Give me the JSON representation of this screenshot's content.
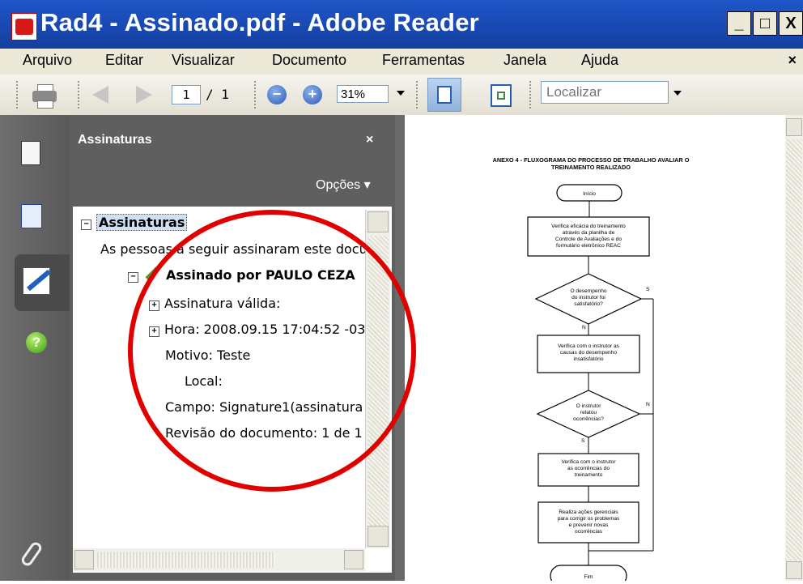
{
  "window": {
    "title": "Rad4 - Assinado.pdf - Adobe Reader",
    "buttons": [
      "_",
      "□",
      "X"
    ]
  },
  "menu": {
    "items": [
      "Arquivo",
      "Editar",
      "Visualizar",
      "Documento",
      "Ferramentas",
      "Janela",
      "Ajuda"
    ],
    "close": "×"
  },
  "toolbar": {
    "page_current": "1",
    "page_total": "/ 1",
    "zoom_out": "−",
    "zoom_in": "+",
    "zoom": "31%",
    "search_placeholder": "Localizar"
  },
  "nav": {
    "icons": [
      "pages-icon",
      "bookmarks-icon",
      "signatures-icon",
      "help-icon",
      "attachment-icon"
    ],
    "help_glyph": "?"
  },
  "panel": {
    "title": "Assinaturas",
    "close": "×",
    "options": "Opções ▾",
    "tree": {
      "root": "Assinaturas",
      "intro": "As pessoas a seguir assinaram este docu",
      "signed_by": "Assinado por PAULO CEZA",
      "validity": "Assinatura válida:",
      "time": "Hora: 2008.09.15 17:04:52 -03",
      "reason": "Motivo: Teste",
      "location": "Local:",
      "field": "Campo: Signature1(assinatura",
      "revision": "Revisão do documento: 1 de 1"
    }
  },
  "document": {
    "title_line1": "ANEXO 4 - FLUXOGRAMA DO PROCESSO DE TRABALHO AVALIAR O",
    "title_line2": "TREINAMENTO REALIZADO",
    "start": "Início",
    "box1": [
      "Verifica eficácia do treinamento",
      "através da planilha de",
      "Controle de Avaliações e do",
      "formulário eletrônico REAC"
    ],
    "decision1": [
      "O desempenho",
      "do instrutor foi",
      "satisfatório?"
    ],
    "yes": "S",
    "no": "N",
    "box2": [
      "Verifica com o instrutor as",
      "causas do desempenho",
      "insatisfatório"
    ],
    "decision2": [
      "O instrutor",
      "relatou",
      "ocorrências?"
    ],
    "box3": [
      "Verifica com o instrutor",
      "as ocorrências do",
      "treinamento"
    ],
    "box4": [
      "Realiza ações gerenciais",
      "para corrigir os problemas",
      "e prevenir novas",
      "ocorrências"
    ],
    "end": "Fim"
  },
  "colors": {
    "title_bar": "#1848b0",
    "annotation_circle": "#e00000",
    "panel_bg": "#5f5f5f"
  }
}
